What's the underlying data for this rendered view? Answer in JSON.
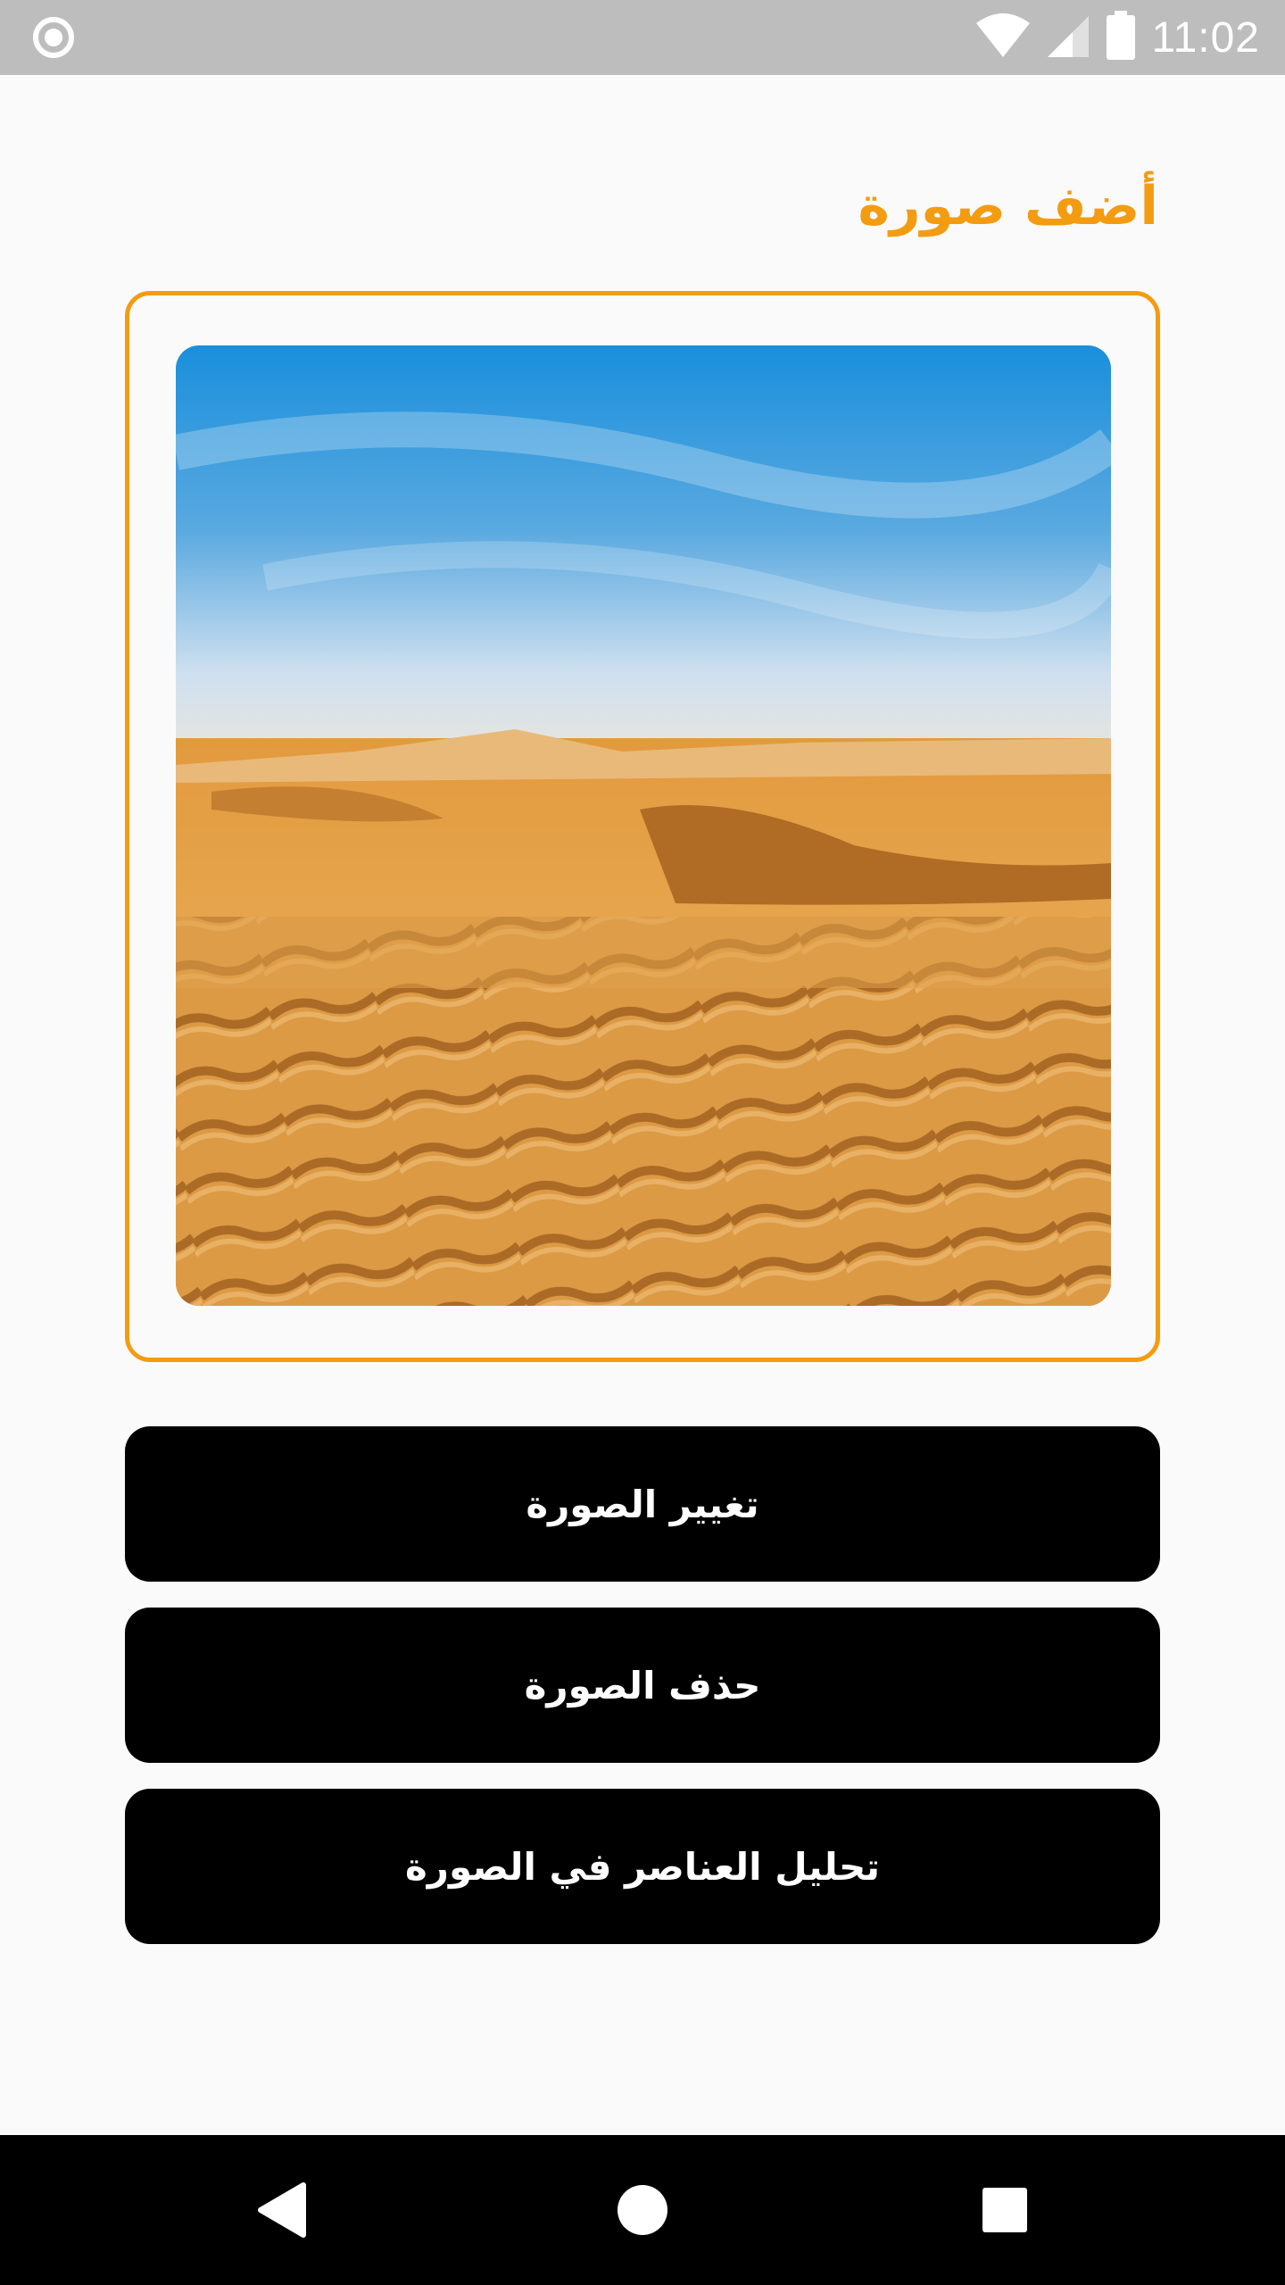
{
  "status_bar": {
    "time": "11:02",
    "icons": [
      "record-icon",
      "wifi-icon",
      "signal-icon",
      "battery-icon"
    ]
  },
  "page": {
    "title": "أضف صورة"
  },
  "image": {
    "icon": "desert-dunes-photo"
  },
  "buttons": {
    "change_label": "تغيير الصورة",
    "delete_label": "حذف الصورة",
    "analyze_label": "تحليل العناصر في الصورة"
  },
  "nav_bar": {
    "icons": [
      "back-icon",
      "home-icon",
      "recents-icon"
    ]
  },
  "colors": {
    "accent": "#f39c12",
    "button_bg": "#000000",
    "button_text": "#ffffff",
    "status_bar_bg": "#bdbdbd",
    "background": "#fafafa"
  }
}
